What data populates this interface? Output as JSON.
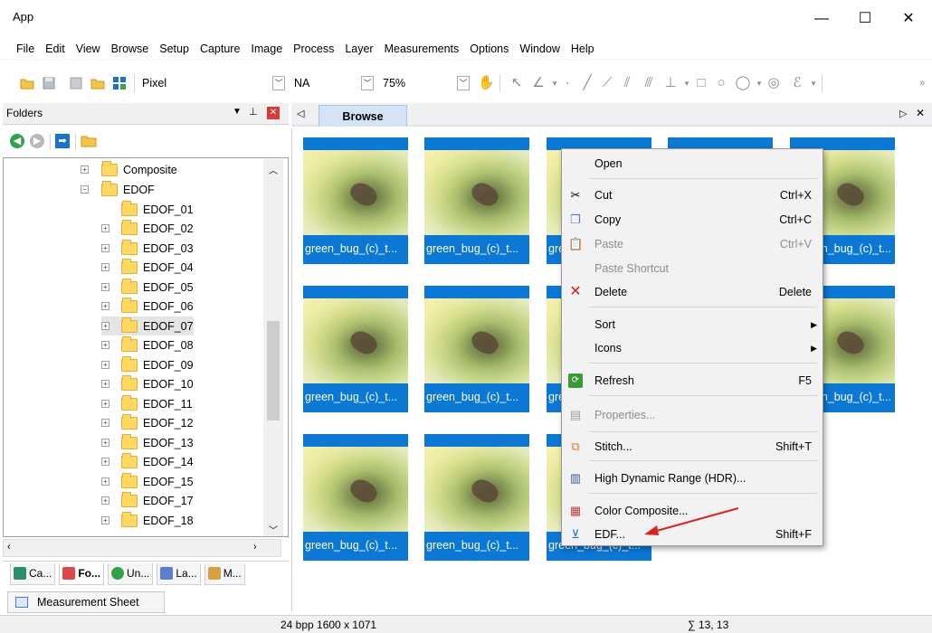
{
  "window": {
    "title": "App",
    "minimize": "—",
    "maximize": "☐",
    "close": "✕"
  },
  "menu": [
    "File",
    "Edit",
    "View",
    "Browse",
    "Setup",
    "Capture",
    "Image",
    "Process",
    "Layer",
    "Measurements",
    "Options",
    "Window",
    "Help"
  ],
  "toolbar": {
    "unit_value": "Pixel",
    "na_value": "NA",
    "zoom_value": "75%"
  },
  "folders_panel": {
    "title": "Folders",
    "tree": [
      {
        "label": "Composite",
        "expander": "+"
      },
      {
        "label": "EDOF",
        "expander": "−"
      },
      {
        "label": "EDOF_01",
        "expander": ""
      },
      {
        "label": "EDOF_02",
        "expander": "+"
      },
      {
        "label": "EDOF_03",
        "expander": "+"
      },
      {
        "label": "EDOF_04",
        "expander": "+"
      },
      {
        "label": "EDOF_05",
        "expander": "+"
      },
      {
        "label": "EDOF_06",
        "expander": "+"
      },
      {
        "label": "EDOF_07",
        "expander": "+"
      },
      {
        "label": "EDOF_08",
        "expander": "+"
      },
      {
        "label": "EDOF_09",
        "expander": "+"
      },
      {
        "label": "EDOF_10",
        "expander": "+"
      },
      {
        "label": "EDOF_11",
        "expander": "+"
      },
      {
        "label": "EDOF_12",
        "expander": "+"
      },
      {
        "label": "EDOF_13",
        "expander": "+"
      },
      {
        "label": "EDOF_14",
        "expander": "+"
      },
      {
        "label": "EDOF_15",
        "expander": "+"
      },
      {
        "label": "EDOF_17",
        "expander": "+"
      },
      {
        "label": "EDOF_18",
        "expander": "+"
      }
    ],
    "tabs": [
      "Ca...",
      "Fo...",
      "Un...",
      "La...",
      "M..."
    ]
  },
  "measurement_sheet": "Measurement Sheet",
  "doc_tab": "Browse",
  "thumbnails": {
    "label": "green_bug_(c)_t..."
  },
  "context_menu": {
    "open": "Open",
    "cut": "Cut",
    "cut_sc": "Ctrl+X",
    "copy": "Copy",
    "copy_sc": "Ctrl+C",
    "paste": "Paste",
    "paste_sc": "Ctrl+V",
    "paste_shortcut": "Paste Shortcut",
    "delete": "Delete",
    "delete_sc": "Delete",
    "sort": "Sort",
    "icons": "Icons",
    "refresh": "Refresh",
    "refresh_sc": "F5",
    "properties": "Properties...",
    "stitch": "Stitch...",
    "stitch_sc": "Shift+T",
    "hdr": "High Dynamic Range (HDR)...",
    "color_composite": "Color Composite...",
    "edf": "EDF...",
    "edf_sc": "Shift+F"
  },
  "status": {
    "image_info": "24 bpp  1600 x 1071",
    "sum": "∑  13, 13"
  },
  "colors": {
    "accent": "#0a78d4",
    "arrow": "#e02020"
  }
}
